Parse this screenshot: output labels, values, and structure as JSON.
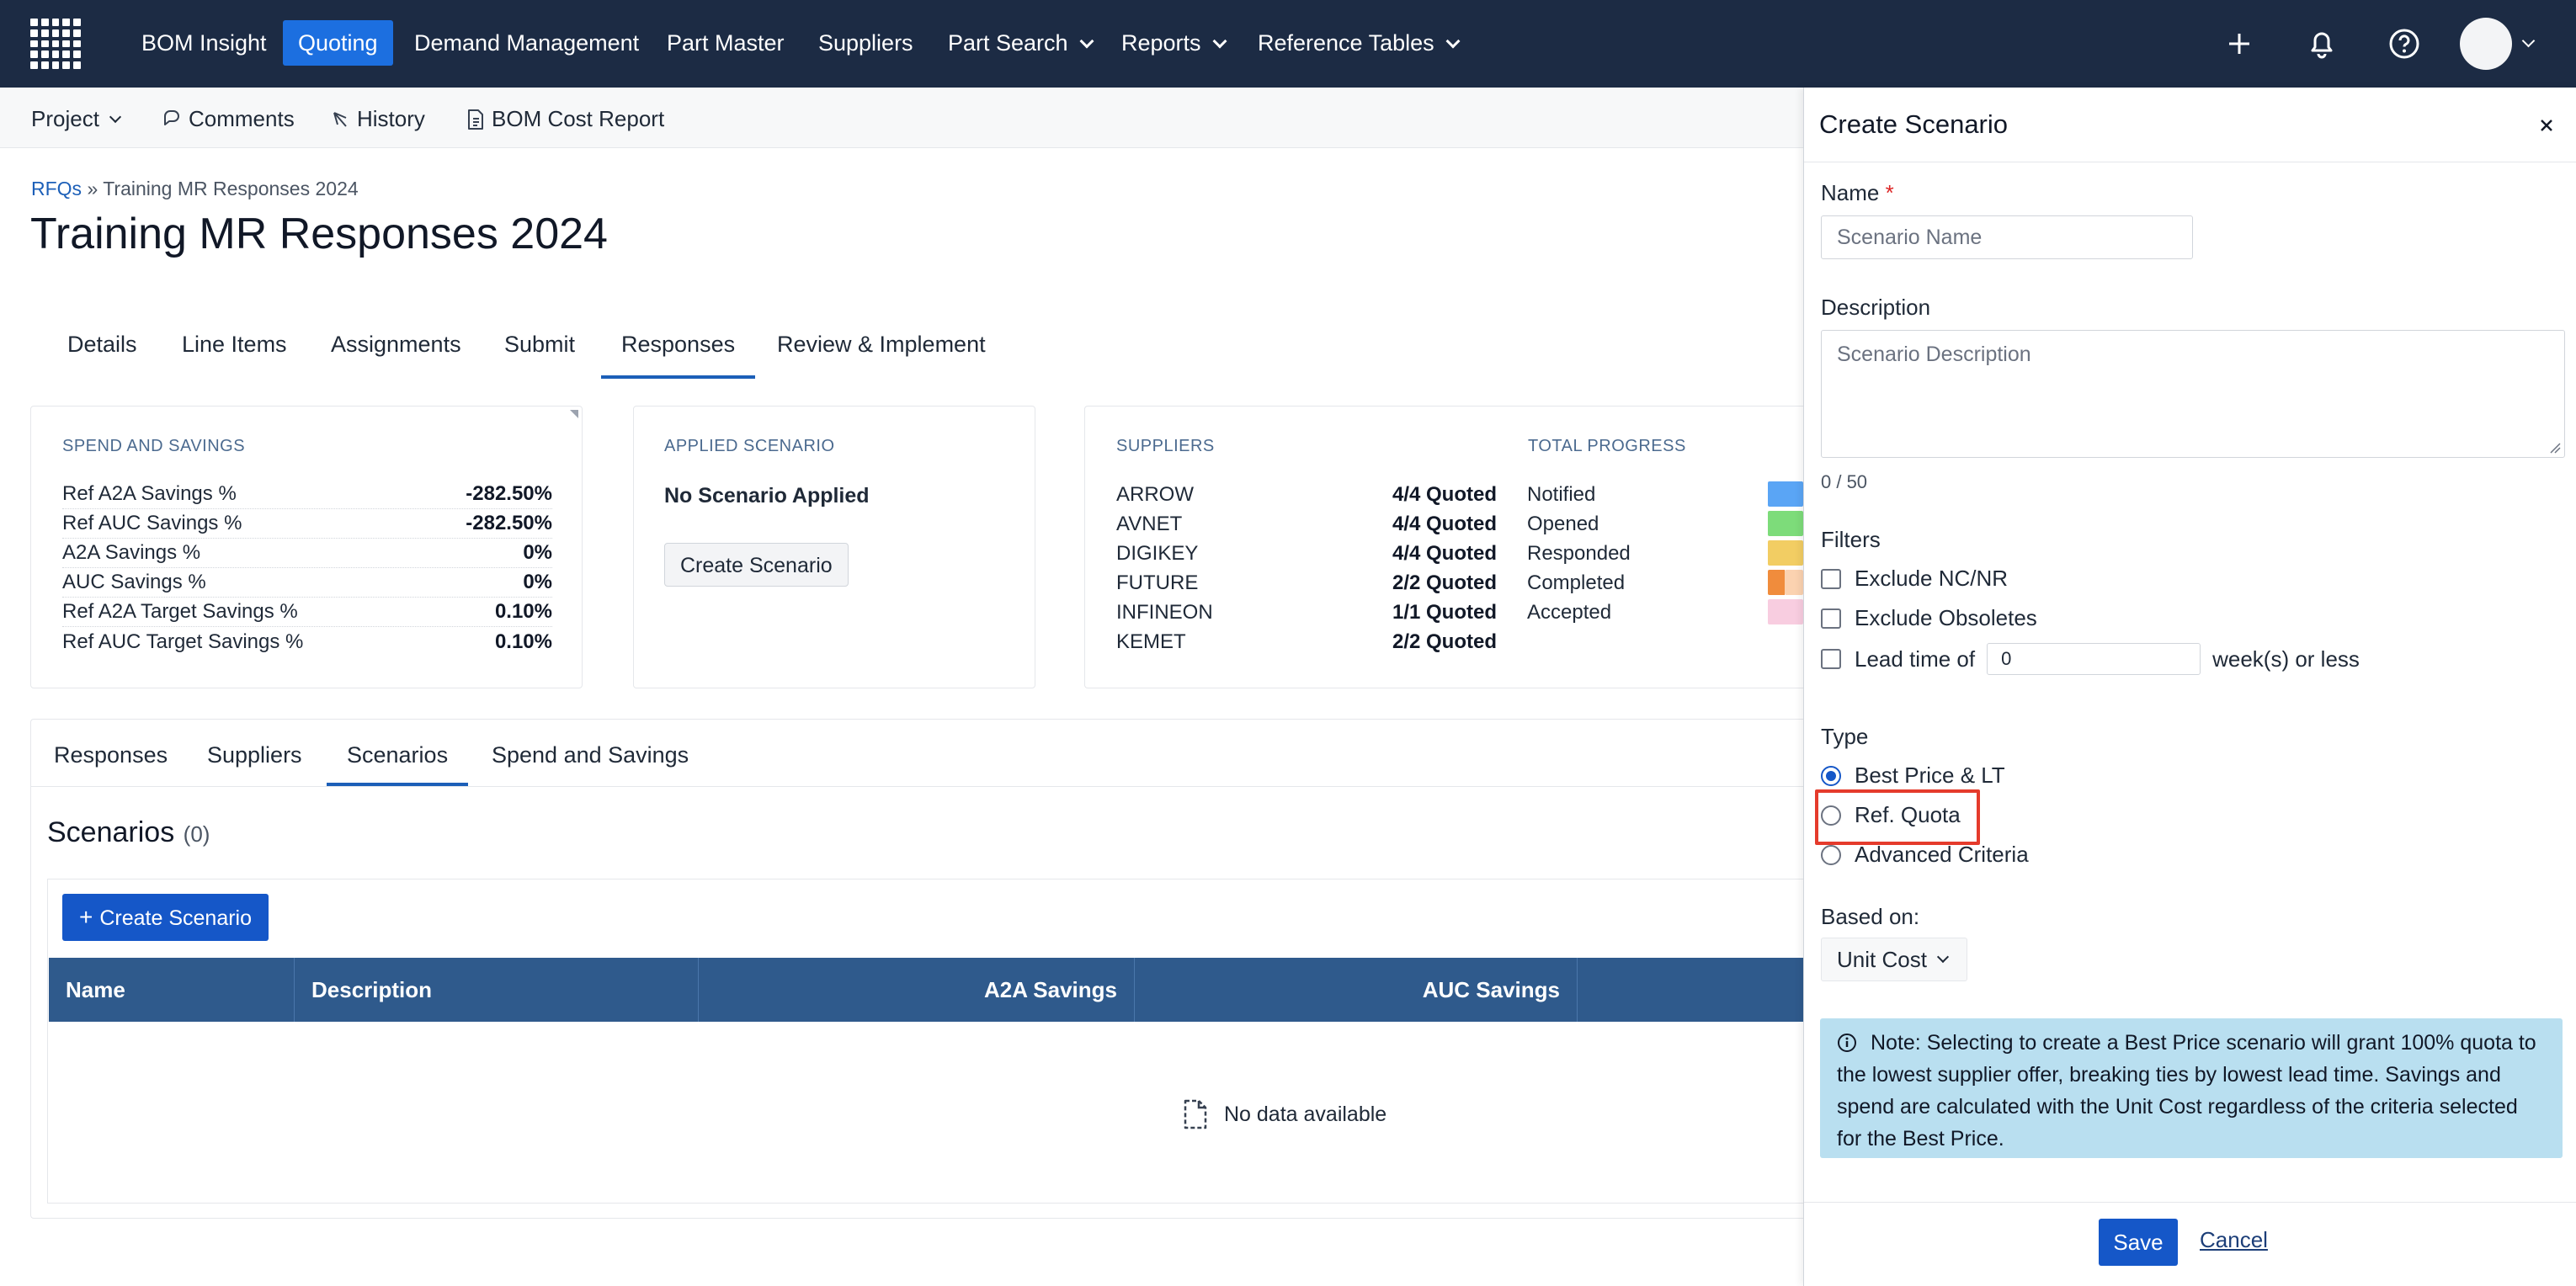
{
  "nav": {
    "items": [
      {
        "label": "BOM Insight",
        "active": false,
        "dropdown": false
      },
      {
        "label": "Quoting",
        "active": true,
        "dropdown": false
      },
      {
        "label": "Demand Management",
        "active": false,
        "dropdown": false
      },
      {
        "label": "Part Master",
        "active": false,
        "dropdown": false
      },
      {
        "label": "Suppliers",
        "active": false,
        "dropdown": false
      },
      {
        "label": "Part Search",
        "active": false,
        "dropdown": true
      },
      {
        "label": "Reports",
        "active": false,
        "dropdown": true
      },
      {
        "label": "Reference Tables",
        "active": false,
        "dropdown": true
      }
    ],
    "icons": [
      "plus-icon",
      "bell-icon",
      "help-icon",
      "avatar"
    ]
  },
  "subbar": {
    "project": "Project",
    "comments": "Comments",
    "history": "History",
    "bom_cost_report": "BOM Cost Report"
  },
  "breadcrumb": {
    "link": "RFQs",
    "separator": "»",
    "current": "Training MR Responses 2024"
  },
  "page_title": "Training MR Responses 2024",
  "tabs": [
    "Details",
    "Line Items",
    "Assignments",
    "Submit",
    "Responses",
    "Review & Implement"
  ],
  "active_tab": "Responses",
  "spend_card": {
    "heading": "SPEND AND SAVINGS",
    "rows": [
      {
        "label": "Ref A2A Savings %",
        "value": "-282.50%"
      },
      {
        "label": "Ref AUC Savings %",
        "value": "-282.50%"
      },
      {
        "label": "A2A Savings %",
        "value": "0%"
      },
      {
        "label": "AUC Savings %",
        "value": "0%"
      },
      {
        "label": "Ref A2A Target Savings %",
        "value": "0.10%"
      },
      {
        "label": "Ref AUC Target Savings %",
        "value": "0.10%"
      }
    ]
  },
  "applied_card": {
    "heading": "APPLIED SCENARIO",
    "status": "No Scenario Applied",
    "button": "Create Scenario"
  },
  "suppliers_card": {
    "heading": "SUPPLIERS",
    "rows": [
      {
        "name": "ARROW",
        "value": "4/4 Quoted"
      },
      {
        "name": "AVNET",
        "value": "4/4 Quoted"
      },
      {
        "name": "DIGIKEY",
        "value": "4/4 Quoted"
      },
      {
        "name": "FUTURE",
        "value": "2/2 Quoted"
      },
      {
        "name": "INFINEON",
        "value": "1/1 Quoted"
      },
      {
        "name": "KEMET",
        "value": "2/2 Quoted"
      }
    ]
  },
  "progress_card": {
    "heading": "TOTAL PROGRESS",
    "rows": [
      {
        "label": "Notified",
        "color": "#5aa5f5"
      },
      {
        "label": "Opened",
        "color": "#7ddc7a"
      },
      {
        "label": "Responded",
        "color": "#f2cd63"
      },
      {
        "label": "Completed",
        "color": "#f08c3c"
      },
      {
        "label": "Accepted",
        "color": "#f8cde0"
      }
    ]
  },
  "subtabs": [
    "Responses",
    "Suppliers",
    "Scenarios",
    "Spend and Savings"
  ],
  "active_subtab": "Scenarios",
  "scenarios": {
    "title": "Scenarios",
    "count": "(0)",
    "create_button": "Create Scenario",
    "columns": [
      "Name",
      "Description",
      "A2A Savings",
      "AUC Savings"
    ],
    "empty_text": "No data available"
  },
  "panel": {
    "title": "Create Scenario",
    "name_label": "Name",
    "required_mark": "*",
    "name_placeholder": "Scenario Name",
    "description_label": "Description",
    "description_placeholder": "Scenario Description",
    "counter": "0 / 50",
    "filters_label": "Filters",
    "filters": {
      "exclude_ncnr": "Exclude NC/NR",
      "exclude_obsoletes": "Exclude Obsoletes",
      "lead_time_label": "Lead time of",
      "lead_time_value": "0",
      "lead_time_suffix": "week(s) or less"
    },
    "type_label": "Type",
    "types": [
      "Best Price & LT",
      "Ref. Quota",
      "Advanced Criteria"
    ],
    "selected_type": "Best Price & LT",
    "based_on_label": "Based on:",
    "based_on_value": "Unit Cost",
    "note": "Note: Selecting to create a Best Price scenario will grant 100% quota to the lowest supplier offer, breaking ties by lowest lead time. Savings and spend are calculated with the Unit Cost regardless of the criteria selected for the Best Price.",
    "save": "Save",
    "cancel": "Cancel"
  }
}
